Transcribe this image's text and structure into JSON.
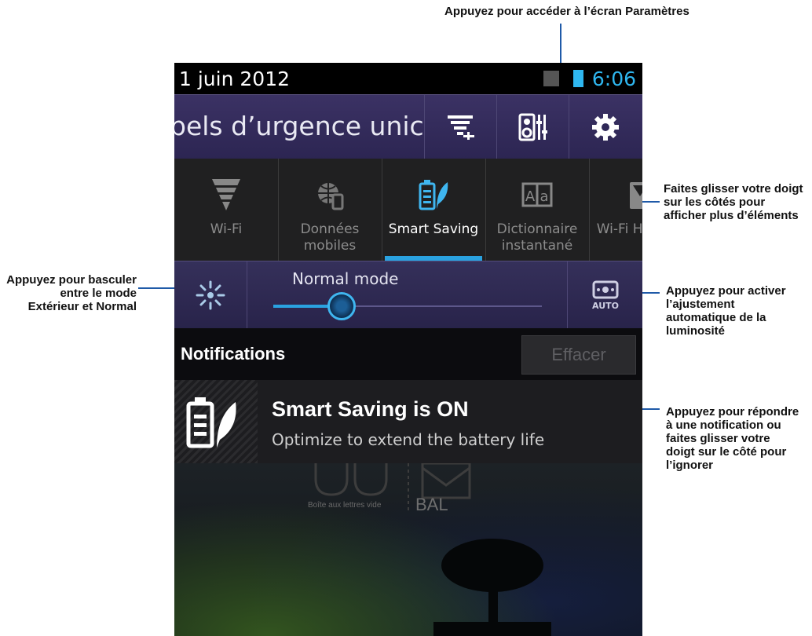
{
  "callouts": {
    "settings": "Appuyez pour accéder à l’écran Paramètres",
    "swipe": "Faites glisser votre doigt sur les côtés pour afficher plus d’éléments",
    "mode": "Appuyez pour basculer entre le mode Extérieur et Normal",
    "auto": "Appuyez pour activer l’ajustement automatique de la luminosité",
    "notification": "Appuyez pour répondre à une notification ou faites glisser votre doigt sur le côté pour l’ignorer"
  },
  "status": {
    "date": "1 juin 2012",
    "time": "6:06",
    "accent": "#2fb7f0"
  },
  "header": {
    "marquee": "pels d’urgence unic"
  },
  "quick_settings": [
    {
      "label": "Wi-Fi",
      "icon": "wifi-icon"
    },
    {
      "label": "Données mobiles",
      "icon": "mobile-data-icon"
    },
    {
      "label": "Smart Saving",
      "icon": "smart-saving-icon",
      "active": true
    },
    {
      "label": "Dictionnaire instantané",
      "icon": "dictionary-icon"
    },
    {
      "label": "Wi-Fi Hotspot",
      "icon": "hotspot-icon"
    }
  ],
  "brightness": {
    "mode_label": "Normal mode",
    "level": 0.25,
    "auto_label": "AUTO"
  },
  "notifications": {
    "title": "Notifications",
    "clear": "Effacer",
    "items": [
      {
        "title": "Smart Saving is ON",
        "body": "Optimize to extend the battery life"
      }
    ]
  },
  "home": {
    "mail_empty": "Boîte aux lettres vide",
    "bal": "BAL"
  }
}
